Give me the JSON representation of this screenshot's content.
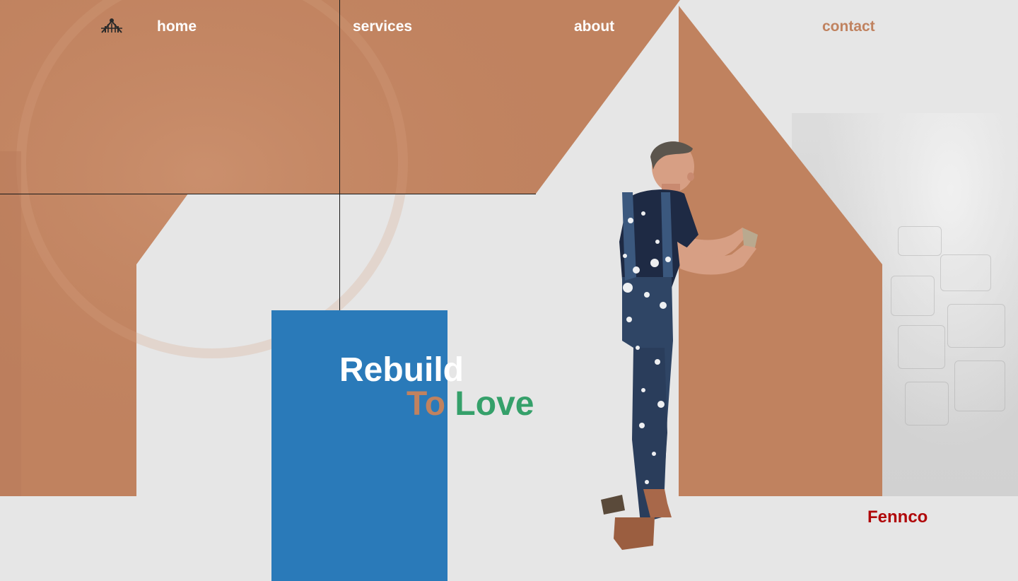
{
  "nav": {
    "logo_icon": "house-tools-logo-icon",
    "home_label": "home",
    "services_label": "services",
    "about_label": "about",
    "contact_label": "contact"
  },
  "hero": {
    "headline_line1": "Rebuild",
    "headline_word2": "To",
    "headline_word3": "Love",
    "image": "painter-worker-in-overalls"
  },
  "brand": {
    "name": "Fennco"
  },
  "colors": {
    "terracotta": "#c0825f",
    "blue": "#2a7ab9",
    "green": "#35a06a",
    "brand_red": "#b0080a",
    "background": "#e6e6e6",
    "white": "#ffffff"
  }
}
